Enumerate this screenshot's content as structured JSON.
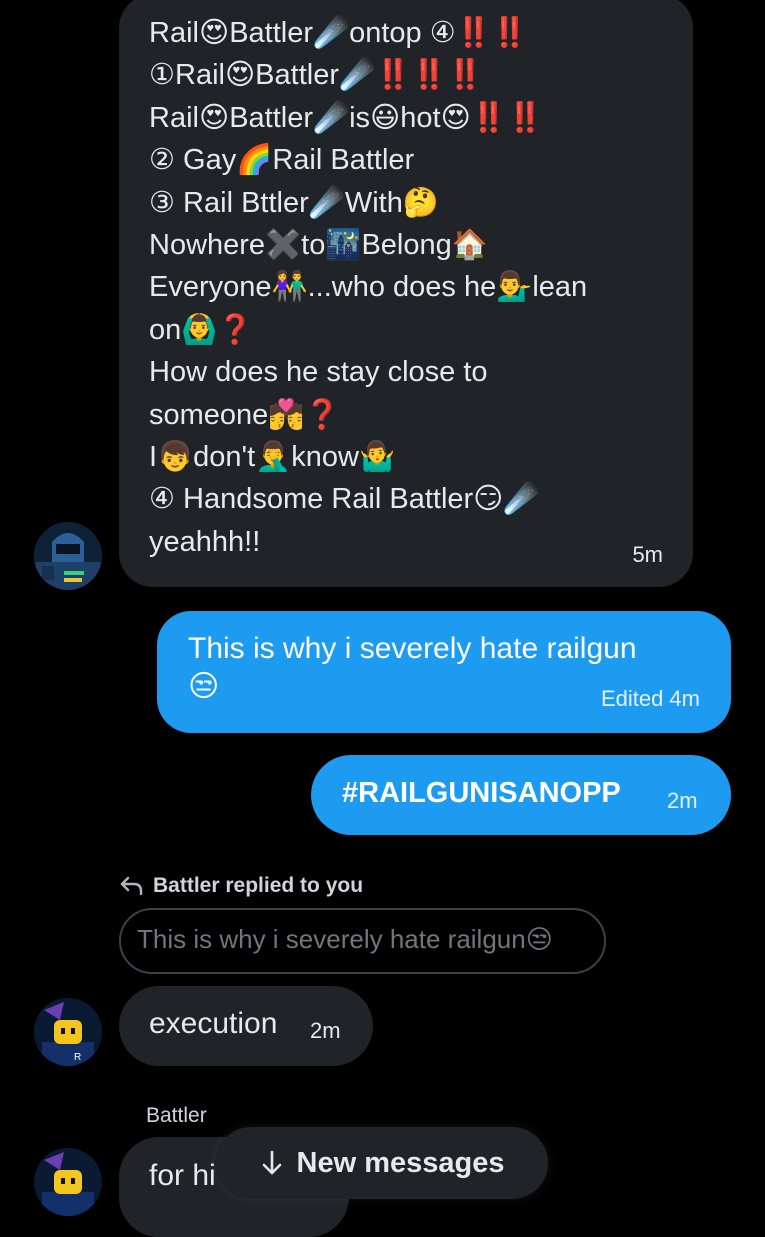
{
  "messages": {
    "first": {
      "lines": [
        "Rail😍Battler☄️ontop ④‼️‼️",
        "①Rail😍Battler☄️‼️‼️‼️",
        "Rail😍Battler☄️is😃hot😍‼️‼️",
        "② Gay🌈Rail Battler",
        "③ Rail Bttler☄️With🤔",
        "Nowhere✖️to🌃Belong🏠",
        "Everyone👫...who does he💁‍♂️lean",
        "on🙆‍♂️❓",
        "How does he stay close to",
        "someone💏❓",
        "I👦don't🤦‍♂️know🤷‍♂️",
        "④ Handsome Rail Battler😏☄️",
        "yeahhh!!"
      ],
      "time": "5m"
    },
    "second": {
      "lines": [
        "This is why i severely hate railgun",
        "😒"
      ],
      "time": "Edited 4m"
    },
    "third": {
      "text": "#RAILGUNISANOPP",
      "time": "2m"
    },
    "reply": {
      "header": "Battler replied to you",
      "quote": "This is why i severely hate railgun😒",
      "text": "execution",
      "time": "2m"
    },
    "last": {
      "sender": "Battler",
      "text": "for hi"
    }
  },
  "new_messages_button": "New messages",
  "colors": {
    "background": "#000000",
    "received_bubble": "#202327",
    "sent_bubble": "#1d9bf0"
  },
  "icons": [
    "reply-arrow-icon",
    "arrow-down-icon",
    "avatar"
  ]
}
